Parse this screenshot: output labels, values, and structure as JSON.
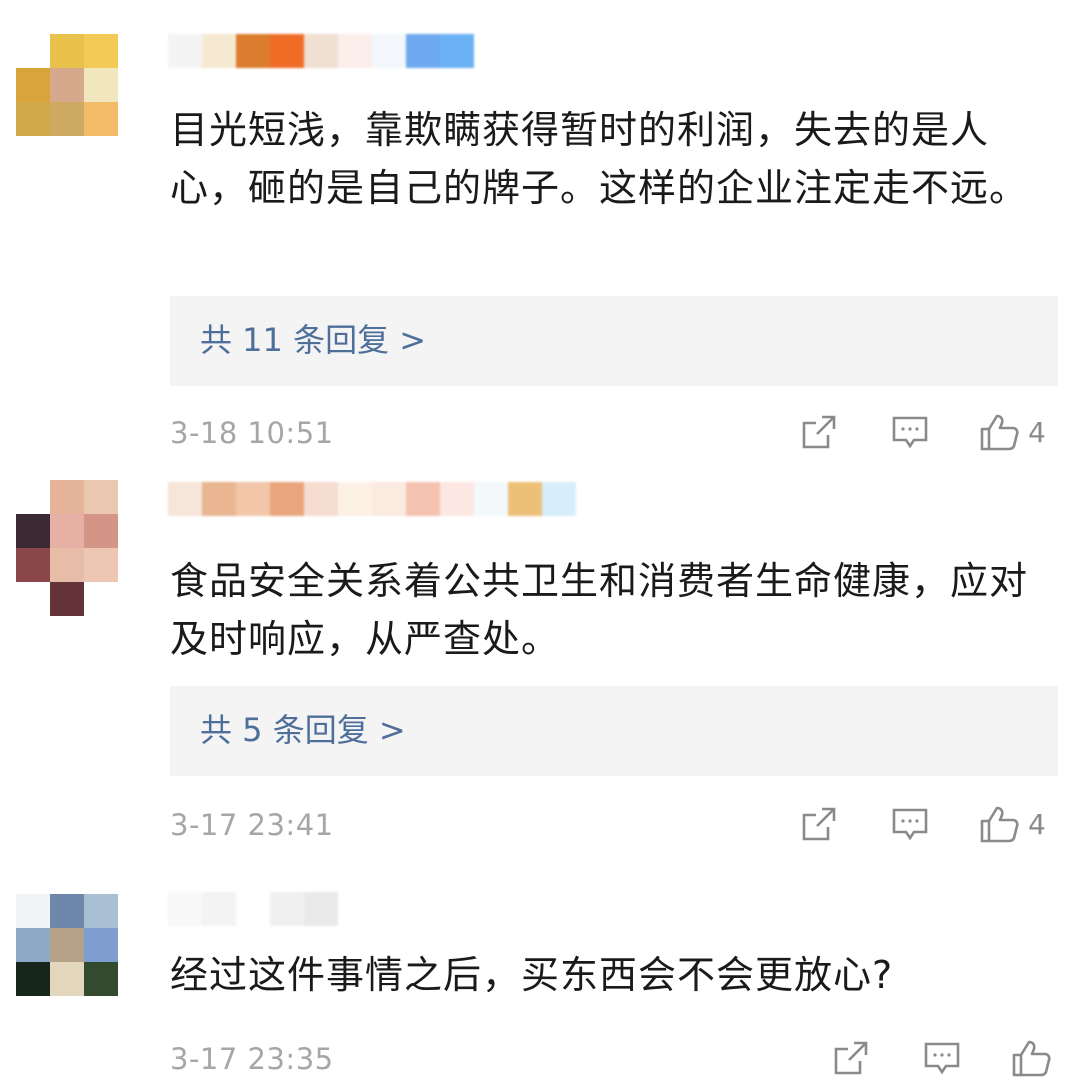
{
  "comments": [
    {
      "avatar_colors": [
        "#ffffff",
        "#e8c24a",
        "#f2ca55",
        "#d9a43a",
        "#d6a98c",
        "#f1e6bd",
        "#d2a94a",
        "#cdaa62",
        "#f4bc68"
      ],
      "name_colors": [
        "#f4f4f4",
        "#f6e9d2",
        "#dc7c2e",
        "#f06d28",
        "#efe0d2",
        "#fbeeeb",
        "#f3f6fb",
        "#6ea9ef",
        "#6bb1f5"
      ],
      "text": "目光短浅，靠欺瞒获得暂时的利润，失去的是人心，砸的是自己的牌子。这样的企业注定走不远。",
      "replies_label": "共 11 条回复 >",
      "time": "3-18 10:51",
      "likes": "4"
    },
    {
      "avatar_colors": [
        "#ffffff",
        "#e6b49a",
        "#ebc7b0",
        "#3b2a34",
        "#e6b0a4",
        "#d59586",
        "#8a4649",
        "#e7bda8",
        "#eec7b4",
        "#ffffff",
        "#64343a",
        "#ffffff"
      ],
      "name_colors": [
        "#f6e6da",
        "#e9b691",
        "#f2c6a9",
        "#e9a67c",
        "#f5ddd2",
        "#fdf1e6",
        "#fbeae0",
        "#f4c2b0",
        "#fde7e2",
        "#f3f8fb",
        "#edc07a",
        "#d7eefa"
      ],
      "text": "食品安全关系着公共卫生和消费者生命健康，应对及时响应，从严查处。",
      "replies_label": "共 5 条回复 >",
      "time": "3-17 23:41",
      "likes": "4"
    },
    {
      "avatar_colors": [
        "#f1f3f5",
        "#6f87aa",
        "#a9bfd4",
        "#8ea8c8",
        "#b6a288",
        "#7e9ed0",
        "#17261a",
        "#e2d6bc",
        "#344a2f"
      ],
      "name_colors": [
        "#f8f8f8",
        "#f3f3f3",
        "#ffffff",
        "#f0f0f0",
        "#e9e9e9"
      ],
      "text": "经过这件事情之后，买东西会不会更放心?",
      "time": "3-17 23:35",
      "likes": ""
    }
  ],
  "icons": {
    "share": "share-icon",
    "comment": "comment-icon",
    "like": "thumbs-up-icon"
  },
  "colors": {
    "link": "#4e6f9a",
    "muted": "#a6a6a6",
    "reply_bg": "#f4f4f4"
  }
}
